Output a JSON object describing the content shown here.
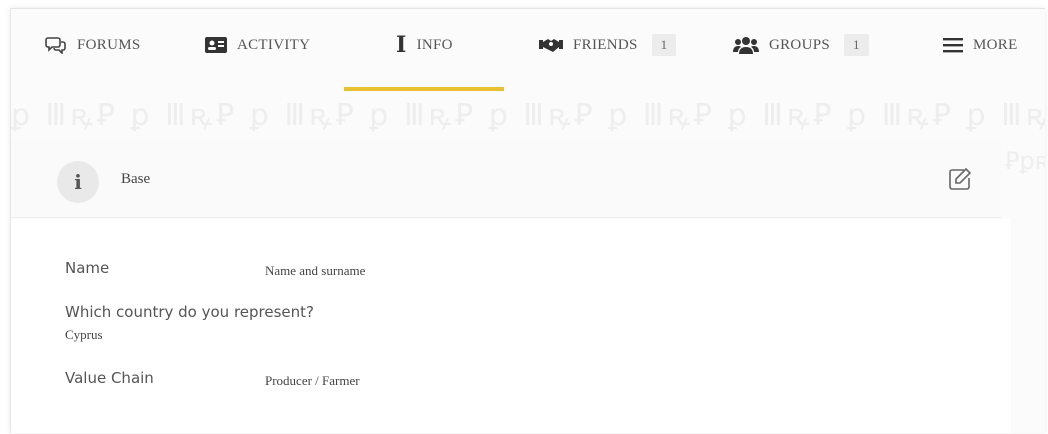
{
  "nav": {
    "tabs": [
      {
        "label": "FORUMS",
        "icon": "chat-bubbles-icon"
      },
      {
        "label": "ACTIVITY",
        "icon": "id-card-icon"
      },
      {
        "label": "INFO",
        "icon": "info-icon",
        "active": true
      },
      {
        "label": "FRIENDS",
        "icon": "handshake-icon",
        "count": "1"
      },
      {
        "label": "GROUPS",
        "icon": "users-icon",
        "count": "1"
      },
      {
        "label": "MORE",
        "icon": "hamburger-menu-icon"
      }
    ],
    "active_color": "#e8c031"
  },
  "section": {
    "title": "Base",
    "icon": "info-icon",
    "edit_icon": "edit-icon"
  },
  "fields": [
    {
      "label": "Name",
      "value": "Name and surname"
    },
    {
      "label": "Which country do you represent?",
      "value": "Cyprus"
    },
    {
      "label": "Value Chain",
      "value": "Producer / Farmer"
    }
  ]
}
